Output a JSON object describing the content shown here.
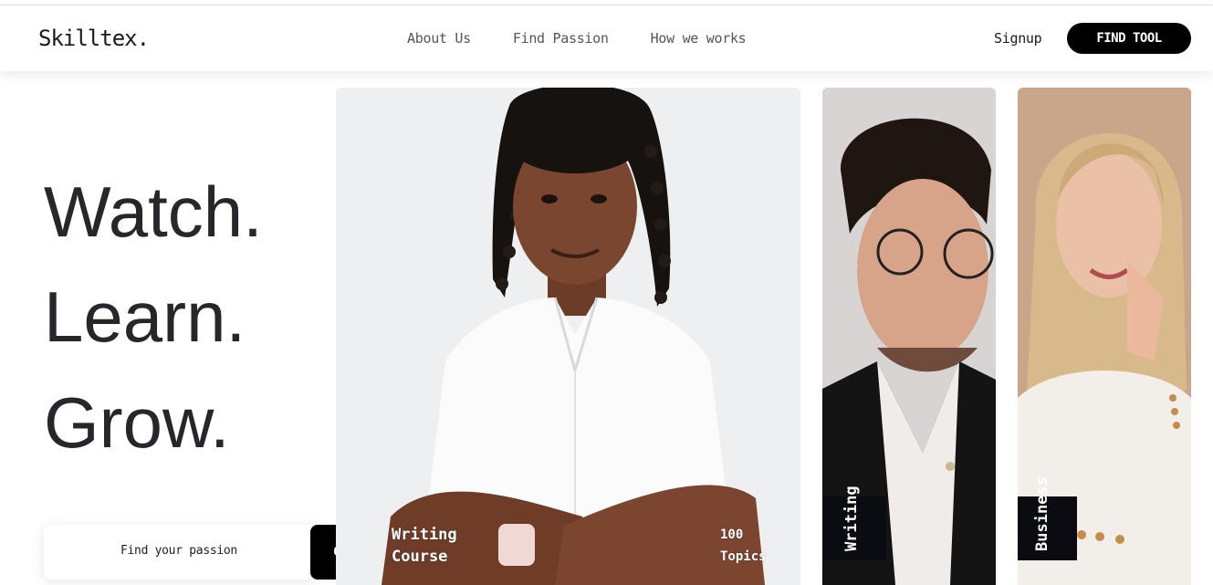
{
  "brand": {
    "logo": "Skilltex."
  },
  "nav": {
    "links": [
      "About Us",
      "Find Passion",
      "How we works"
    ],
    "signup_label": "Signup",
    "cta_label": "FIND TOOL"
  },
  "hero": {
    "lines": [
      "Watch.",
      "Learn.",
      "Grow."
    ]
  },
  "search": {
    "placeholder": "Find your passion",
    "button_label": "Go"
  },
  "cards": [
    {
      "title_line1": "Writing",
      "title_line2": "Course",
      "count": "100",
      "count_label": "Topics"
    },
    {
      "label": "Writing"
    },
    {
      "label": "Business"
    }
  ],
  "colors": {
    "accent": "#000000",
    "hero_text": "#25272b",
    "label_box": "#0b0b12"
  }
}
